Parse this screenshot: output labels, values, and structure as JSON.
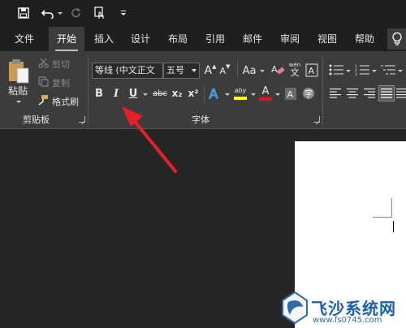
{
  "quick_access": {
    "save_icon": "save-icon",
    "undo_icon": "undo-icon",
    "redo_icon": "redo-icon",
    "touch_mode_icon": "touch-mode-icon",
    "customize_icon": "customize-qat-icon"
  },
  "tabs": [
    {
      "label": "文件"
    },
    {
      "label": "开始"
    },
    {
      "label": "插入"
    },
    {
      "label": "设计"
    },
    {
      "label": "布局"
    },
    {
      "label": "引用"
    },
    {
      "label": "邮件"
    },
    {
      "label": "审阅"
    },
    {
      "label": "视图"
    },
    {
      "label": "帮助"
    }
  ],
  "active_tab": "开始",
  "clipboard": {
    "paste_label": "粘贴",
    "cut_label": "剪切",
    "copy_label": "复制",
    "format_painter_label": "格式刷",
    "group_label": "剪贴板"
  },
  "font": {
    "font_name": "等线 (中文正文",
    "font_size": "五号",
    "group_label": "字体",
    "bold_glyph": "B",
    "italic_glyph": "I",
    "underline_glyph": "U",
    "strike_glyph": "abc",
    "subscript_glyph": "x₂",
    "superscript_glyph": "x²",
    "change_case_glyph": "Aa",
    "grow_glyph": "A",
    "shrink_glyph": "A",
    "phonetic_glyph": "wén",
    "highlight_glyph": "aby",
    "font_color_glyph": "A"
  },
  "colors": {
    "highlight": "#ffff00",
    "font_color": "#e81123",
    "annotation_arrow": "#e8202a",
    "text_effect": "#4aa0e6"
  },
  "watermark": {
    "brand": "飞沙系统网",
    "url": "www.fs0745.com"
  }
}
